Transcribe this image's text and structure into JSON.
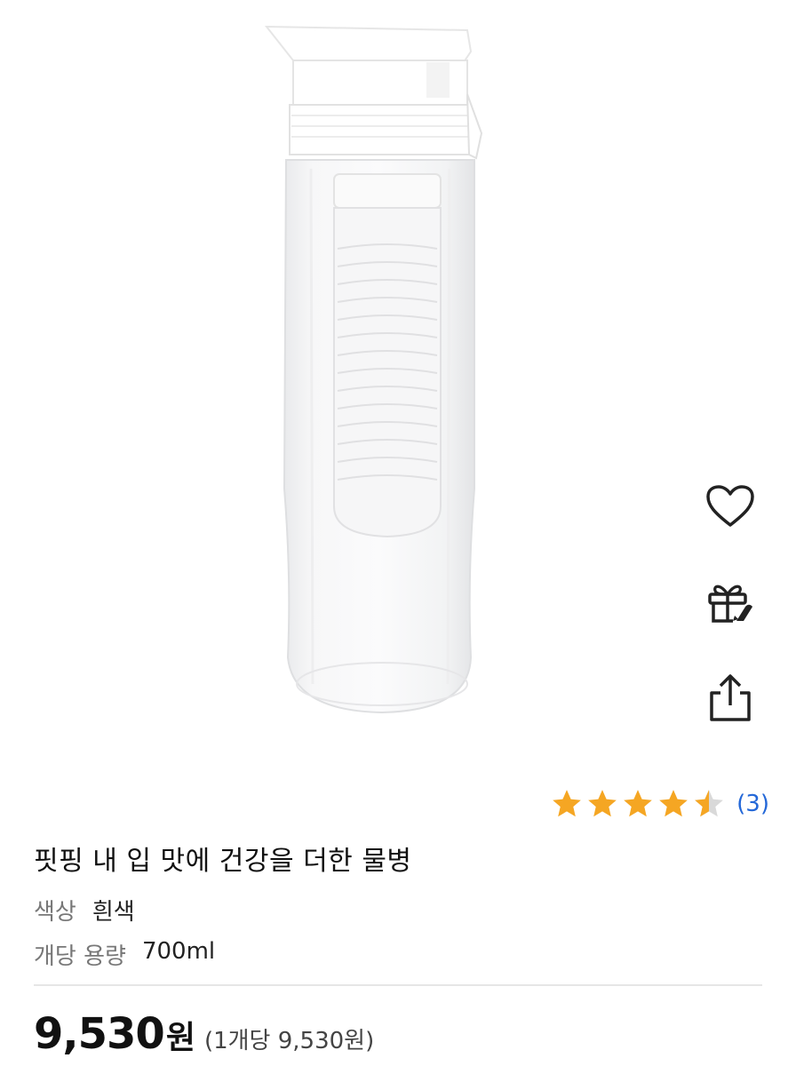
{
  "product": {
    "title": "핏핑 내 입 맛에 건강을 더한 물병",
    "image_alt": "water-bottle-with-infuser"
  },
  "actions": {
    "wishlist_icon": "heart-icon",
    "gift_icon": "gift-icon",
    "share_icon": "share-icon"
  },
  "rating": {
    "score": 4.5,
    "max": 5,
    "review_count": "(3)",
    "star_color": "#f5a623",
    "count_color": "#2468d8"
  },
  "options": {
    "color_label": "색상",
    "color_value": "흰색",
    "capacity_label": "개당 용량",
    "capacity_value": "700ml"
  },
  "price": {
    "value": "9,530",
    "unit": "원",
    "unit_price": "(1개당 9,530원)"
  }
}
